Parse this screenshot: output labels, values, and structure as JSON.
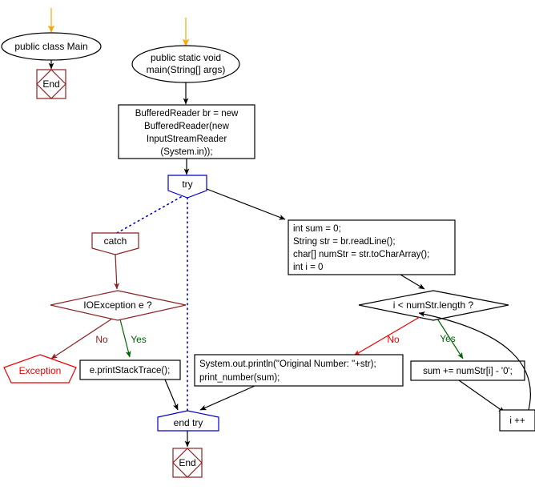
{
  "diagram": {
    "title": "Java flowchart: sum of digits of a number read from input",
    "colors": {
      "start_arrow": "#ffa500",
      "black": "#000000",
      "blue": "#0000cc",
      "dark_red": "#8b2222",
      "red": "#ee0000",
      "green": "#006400",
      "background": "#ffffff"
    }
  },
  "nodes": {
    "class_main": {
      "label": "public class Main",
      "shape": "ellipse",
      "color": "#000000"
    },
    "end_left": {
      "label": "End",
      "shape": "square-diamond",
      "color": "#8b2222"
    },
    "main_method": {
      "label_line1": "public static void",
      "label_line2": "main(String[] args)",
      "shape": "ellipse",
      "color": "#000000"
    },
    "buffered_reader": {
      "shape": "rect",
      "color": "#000000",
      "lines": [
        "BufferedReader br = new",
        "BufferedReader(new",
        "InputStreamReader",
        "(System.in));"
      ]
    },
    "try": {
      "label": "try",
      "shape": "pentagon-down",
      "color": "#0000cc"
    },
    "catch": {
      "label": "catch",
      "shape": "pentagon-down",
      "color": "#8b2222"
    },
    "io_exception_decision": {
      "label": "IOException e ?",
      "shape": "diamond",
      "color": "#8b2222"
    },
    "exception": {
      "label": "Exception",
      "shape": "pentagon-up",
      "color": "#ee0000"
    },
    "print_stack_trace": {
      "label": "e.printStackTrace();",
      "shape": "rect",
      "color": "#000000"
    },
    "init_block": {
      "shape": "rect",
      "color": "#000000",
      "lines": [
        "int sum = 0;",
        "String str = br.readLine();",
        "char[] numStr = str.toCharArray();",
        "int i = 0"
      ]
    },
    "loop_decision": {
      "label": "i < numStr.length ?",
      "shape": "diamond",
      "color": "#000000"
    },
    "sum_accum": {
      "label": "sum += numStr[i] - '0';",
      "shape": "rect",
      "color": "#000000"
    },
    "increment": {
      "label": "i ++",
      "shape": "rect",
      "color": "#000000"
    },
    "print_result": {
      "shape": "rect",
      "color": "#000000",
      "lines": [
        "System.out.println(\"Original Number: \"+str);",
        "print_number(sum);"
      ]
    },
    "end_try": {
      "label": "end try",
      "shape": "pentagon-up-flat",
      "color": "#0000cc"
    },
    "end_bottom": {
      "label": "End",
      "shape": "square-diamond",
      "color": "#8b2222"
    }
  },
  "edge_labels": {
    "io_no": "No",
    "io_yes": "Yes",
    "loop_no": "No",
    "loop_yes": "Yes"
  }
}
